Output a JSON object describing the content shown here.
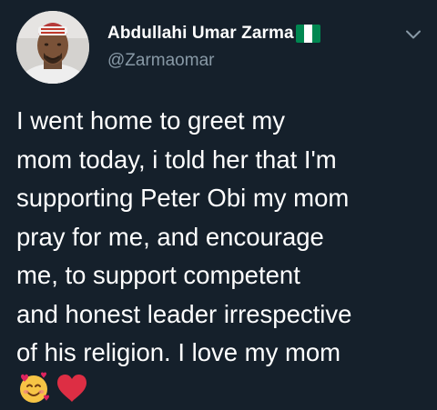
{
  "author": {
    "display_name": "Abdullahi Umar Zarma",
    "username": "@Zarmaomar",
    "flag": "nigeria-flag",
    "flag_colors": [
      "#008751",
      "#ffffff",
      "#008751"
    ]
  },
  "tweet": {
    "text": "I went home to greet my\nmom today, i told her that I'm\nsupporting Peter Obi my mom\npray for me, and encourage\nme, to support competent\nand honest leader irrespective\nof his religion.  I love my mom"
  },
  "emojis": [
    "smiling-face-with-hearts-icon",
    "red-heart-icon"
  ],
  "colors": {
    "background": "#15202b",
    "text_primary": "#ffffff",
    "text_secondary": "#8899a6"
  }
}
